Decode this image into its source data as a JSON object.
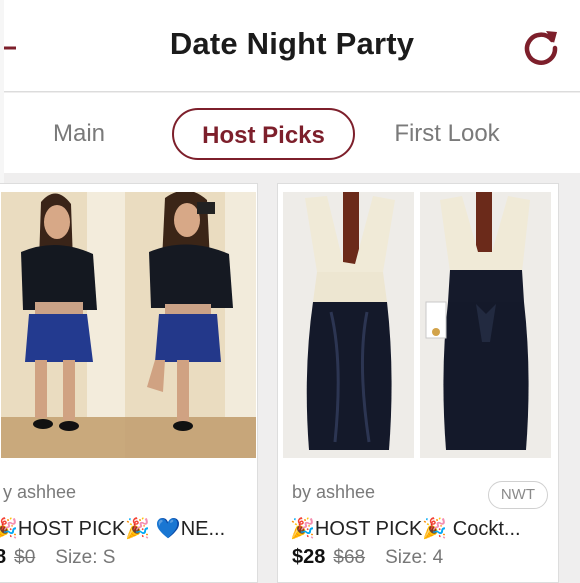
{
  "header": {
    "title": "Date Night Party",
    "accent_color": "#7d1f2b",
    "icons": [
      "back-arrow-icon",
      "refresh-icon"
    ]
  },
  "tabs": [
    {
      "label": "Main",
      "active": false
    },
    {
      "label": "Host Picks",
      "active": true
    },
    {
      "label": "First Look",
      "active": false
    }
  ],
  "listings": [
    {
      "byline": "y ashhee",
      "title": "🎉HOST PICK🎉 💙NE...",
      "price": "8",
      "original_price": "$0",
      "size": "Size: S"
    },
    {
      "byline": "by ashhee",
      "badge": "NWT",
      "title": "🎉HOST PICK🎉 Cockt...",
      "price": "$28",
      "original_price": "$68",
      "size": "Size: 4"
    }
  ]
}
